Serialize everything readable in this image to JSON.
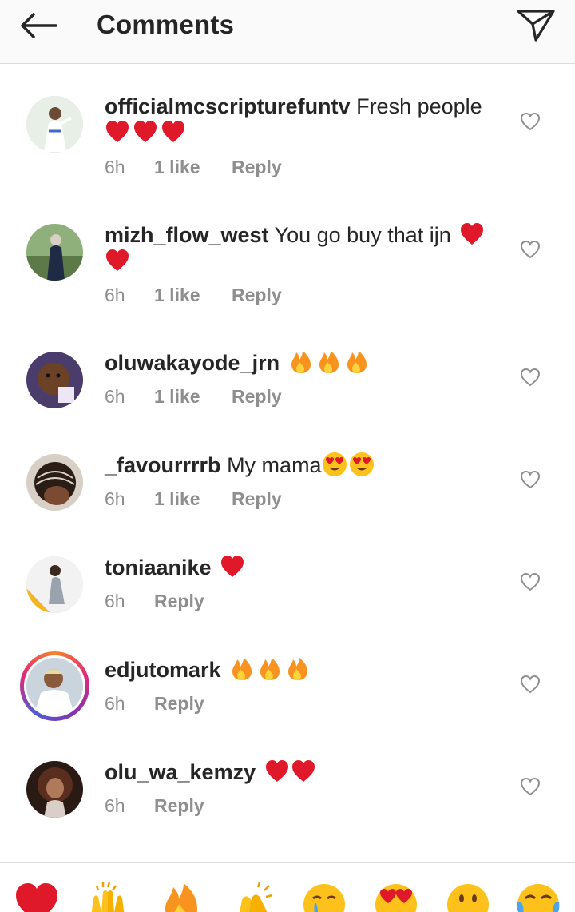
{
  "header": {
    "title": "Comments",
    "back_icon": "arrow-left-icon",
    "send_icon": "paper-plane-icon"
  },
  "comments": [
    {
      "username": "officialmcscripturefuntv",
      "text": "Fresh people",
      "emojis": [
        "red-heart",
        "red-heart",
        "red-heart"
      ],
      "time": "6h",
      "likes": "1 like",
      "reply": "Reply"
    },
    {
      "username": "mizh_flow_west",
      "text": "You go buy that ijn",
      "emojis": [
        "red-heart",
        "red-heart"
      ],
      "time": "6h",
      "likes": "1 like",
      "reply": "Reply"
    },
    {
      "username": "oluwakayode_jrn",
      "text": "",
      "emojis": [
        "fire",
        "fire",
        "fire"
      ],
      "time": "6h",
      "likes": "1 like",
      "reply": "Reply"
    },
    {
      "username": "_favourrrrb",
      "text": "My mama",
      "emojis": [
        "heart-eyes",
        "heart-eyes"
      ],
      "time": "6h",
      "likes": "1 like",
      "reply": "Reply"
    },
    {
      "username": "toniaanike",
      "text": "",
      "emojis": [
        "red-heart"
      ],
      "time": "6h",
      "likes": "",
      "reply": "Reply"
    },
    {
      "username": "edjutomark",
      "text": "",
      "emojis": [
        "fire",
        "fire",
        "fire"
      ],
      "time": "6h",
      "likes": "",
      "reply": "Reply"
    },
    {
      "username": "olu_wa_kemzy",
      "text": "",
      "emojis": [
        "red-heart",
        "red-heart"
      ],
      "time": "6h",
      "likes": "",
      "reply": "Reply"
    }
  ],
  "quick_emojis": [
    "red-heart",
    "raising-hands",
    "fire",
    "clapping-hands",
    "crying-face",
    "heart-eyes",
    "surprised-face",
    "tears-of-joy"
  ],
  "colors": {
    "text": "#262626",
    "meta": "#8e8e8e",
    "heart": "#e0192a",
    "fire": "#f7931e",
    "divider": "#dbdbdb"
  }
}
